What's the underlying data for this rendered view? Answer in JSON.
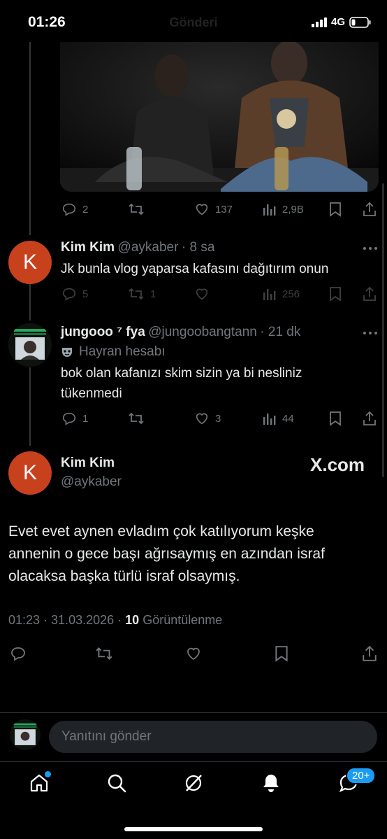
{
  "status_bar": {
    "time": "01:26",
    "network": "4G"
  },
  "header": {
    "title": "Gönderi"
  },
  "parent_tweet": {
    "actions": {
      "replies": "2",
      "likes": "137",
      "views": "2,9B"
    }
  },
  "reply1": {
    "avatar_letter": "K",
    "name": "Kim Kim",
    "handle": "@aykaber",
    "time": "· 8 sa",
    "text": "Jk bunla vlog yaparsa kafasını dağıtırım onun",
    "actions": {
      "replies": "5",
      "retweets": "1",
      "views": "256"
    }
  },
  "reply2": {
    "name": "jungooo ⁷ fya",
    "handle": "@jungoobangtann",
    "time": "· 21 dk",
    "fan_label": "Hayran hesabı",
    "text_line1": "bok olan kafanızı skim sizin ya bi nesliniz",
    "text_line2": "tükenmedi",
    "actions": {
      "replies": "1",
      "likes": "3",
      "views": "44"
    }
  },
  "main_tweet": {
    "avatar_letter": "K",
    "name": "Kim Kim",
    "handle": "@aykaber",
    "source": "X.com",
    "text_line1": "Evet evet aynen evladım çok katılıyorum keşke",
    "text_line2": "annenin o gece başı ağrısaymış en azından israf",
    "text_line3": "olacaksa başka türlü israf olsaymış.",
    "timestamp": "01:23 · 31.03.2026 ·",
    "views_count": "10",
    "views_label": "Görüntülenme"
  },
  "reply_composer": {
    "placeholder": "Yanıtını gönder"
  },
  "tab_bar": {
    "messages_badge": "20+"
  },
  "colors": {
    "background": "#000000",
    "accent": "#1d9bf0",
    "avatar": "#c8411d",
    "muted": "#71767b"
  }
}
